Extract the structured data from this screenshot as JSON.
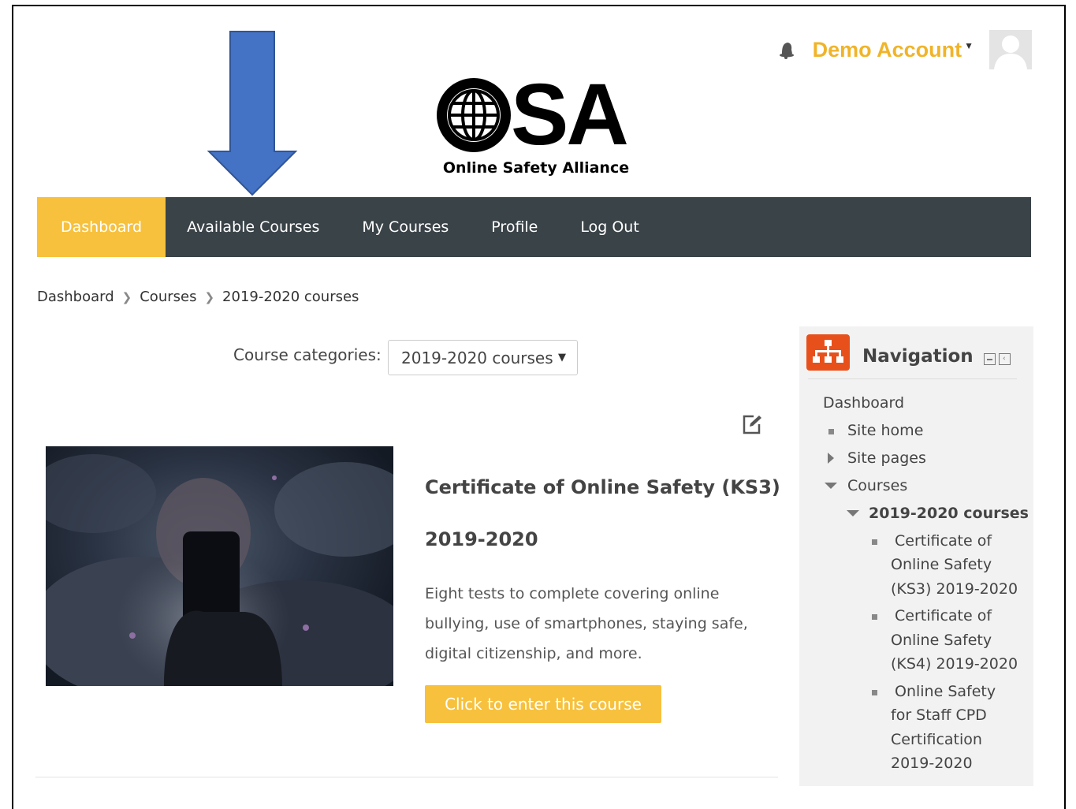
{
  "header": {
    "user_name": "Demo Account",
    "logo_text": "SA",
    "logo_subtitle": "Online Safety Alliance"
  },
  "nav": {
    "items": [
      {
        "label": "Dashboard",
        "active": true
      },
      {
        "label": "Available Courses"
      },
      {
        "label": "My Courses"
      },
      {
        "label": "Profile"
      },
      {
        "label": "Log Out"
      }
    ]
  },
  "breadcrumb": [
    "Dashboard",
    "Courses",
    "2019-2020 courses"
  ],
  "category": {
    "label": "Course categories:",
    "selected": "2019-2020 courses"
  },
  "course": {
    "title": "Certificate of Online Safety (KS3)",
    "year": "2019-2020",
    "description": "Eight tests to complete covering online bullying, use of smartphones, staying safe, digital citizenship, and more.",
    "button": "Click to enter this course"
  },
  "navigation_block": {
    "title": "Navigation",
    "dashboard": "Dashboard",
    "site_home": "Site home",
    "site_pages": "Site pages",
    "courses": "Courses",
    "category": "2019-2020 courses",
    "course1": [
      "Certificate of",
      "Online Safety",
      "(KS3) 2019-2020"
    ],
    "course2": [
      "Certificate of",
      "Online Safety",
      "(KS4) 2019-2020"
    ],
    "course3": [
      "Online Safety",
      "for Staff CPD",
      "Certification",
      "2019-2020"
    ]
  },
  "colors": {
    "accent": "#f7c13d",
    "navbar": "#3a4348",
    "user_name": "#f0b429",
    "nav_icon": "#e8501b",
    "arrow": "#4472c4"
  },
  "icons": [
    "bell-icon",
    "avatar-icon",
    "globe-icon",
    "chevron-right-icon",
    "edit-icon",
    "sitemap-icon",
    "collapse-icon",
    "dock-icon",
    "caret-right-icon",
    "caret-down-icon"
  ]
}
